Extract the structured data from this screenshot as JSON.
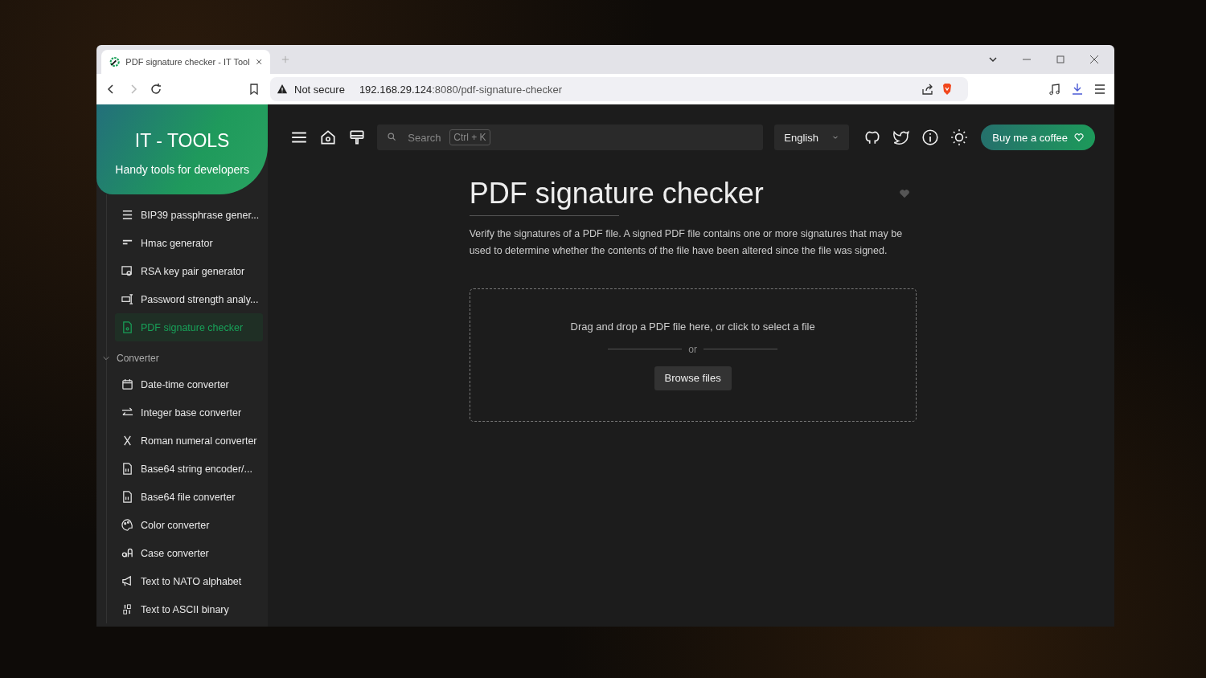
{
  "browser": {
    "tab": {
      "title": "PDF signature checker - IT Tool",
      "selected": true
    },
    "security": "Not secure",
    "url_host": "192.168.29.124",
    "url_rest": ":8080/pdf-signature-checker"
  },
  "sidebar": {
    "title": "IT - TOOLS",
    "subtitle": "Handy tools for developers",
    "items": [
      {
        "label": "BIP39 passphrase gener...",
        "selected": false
      },
      {
        "label": "Hmac generator",
        "selected": false
      },
      {
        "label": "RSA key pair generator",
        "selected": false
      },
      {
        "label": "Password strength analy...",
        "selected": false
      },
      {
        "label": "PDF signature checker",
        "selected": true
      }
    ],
    "groups": [
      {
        "label": "Converter",
        "expanded": true,
        "items": [
          {
            "label": "Date-time converter",
            "selected": false
          },
          {
            "label": "Integer base converter",
            "selected": false
          },
          {
            "label": "Roman numeral converter",
            "selected": false
          },
          {
            "label": "Base64 string encoder/...",
            "selected": false
          },
          {
            "label": "Base64 file converter",
            "selected": false
          },
          {
            "label": "Color converter",
            "selected": false
          },
          {
            "label": "Case converter",
            "selected": false
          },
          {
            "label": "Text to NATO alphabet",
            "selected": false
          },
          {
            "label": "Text to ASCII binary",
            "selected": false
          }
        ]
      }
    ]
  },
  "topbar": {
    "search": {
      "placeholder": "Search",
      "shortcut": "Ctrl + K"
    },
    "language": "English",
    "coffee": "Buy me a coffee"
  },
  "tool": {
    "title": "PDF signature checker",
    "favorite": false,
    "description": "Verify the signatures of a PDF file. A signed PDF file contains one or more signatures that may be used to determine whether the contents of the file have been altered since the file was signed.",
    "dropzone": {
      "text": "Drag and drop a PDF file here, or click to select a file",
      "separator": "or",
      "button": "Browse files"
    }
  }
}
